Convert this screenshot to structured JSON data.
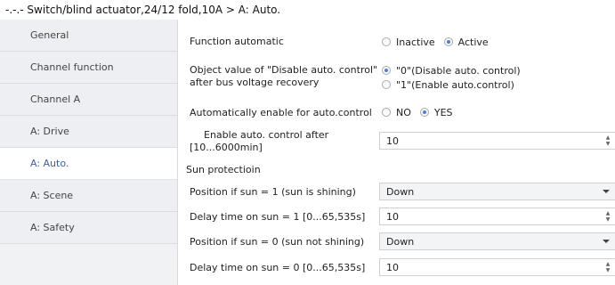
{
  "window": {
    "title": "-.-.- Switch/blind actuator,24/12 fold,10A > A: Auto."
  },
  "sidebar": {
    "items": [
      {
        "label": "General"
      },
      {
        "label": "Channel function"
      },
      {
        "label": "Channel A"
      },
      {
        "label": "A: Drive"
      },
      {
        "label": "A: Auto.",
        "active": true
      },
      {
        "label": "A: Scene"
      },
      {
        "label": "A: Safety"
      }
    ]
  },
  "main": {
    "function_automatic": {
      "label": "Function automatic",
      "options": [
        "Inactive",
        "Active"
      ],
      "selected": "Active"
    },
    "object_value": {
      "label_line1": "Object value of \"Disable auto. control\"",
      "label_line2": "after bus voltage recovery",
      "options": [
        "\"0\"(Disable auto. control)",
        "\"1\"(Enable auto.control)"
      ],
      "selected": "\"0\"(Disable auto. control)"
    },
    "auto_enable": {
      "label": "Automatically enable for auto.control",
      "options": [
        "NO",
        "YES"
      ],
      "selected": "YES"
    },
    "enable_after": {
      "label_line1": "Enable auto. control after",
      "label_line2": "[10...6000min]",
      "value": "10"
    },
    "sun_section": {
      "title": "Sun protectioin"
    },
    "pos_sun1": {
      "label": "Position if sun = 1  (sun is shining)",
      "value": "Down"
    },
    "delay_sun1": {
      "label": "Delay time on sun = 1  [0...65,535s]",
      "value": "10"
    },
    "pos_sun0": {
      "label": "Position if sun = 0  (sun not shining)",
      "value": "Down"
    },
    "delay_sun0": {
      "label": "Delay time on sun = 0   [0...65,535s]",
      "value": "10"
    }
  },
  "colors": {
    "accent": "#4f7fcf",
    "active_tab_text": "#3a5f9c",
    "sidebar_bg": "#f1f2f4"
  }
}
